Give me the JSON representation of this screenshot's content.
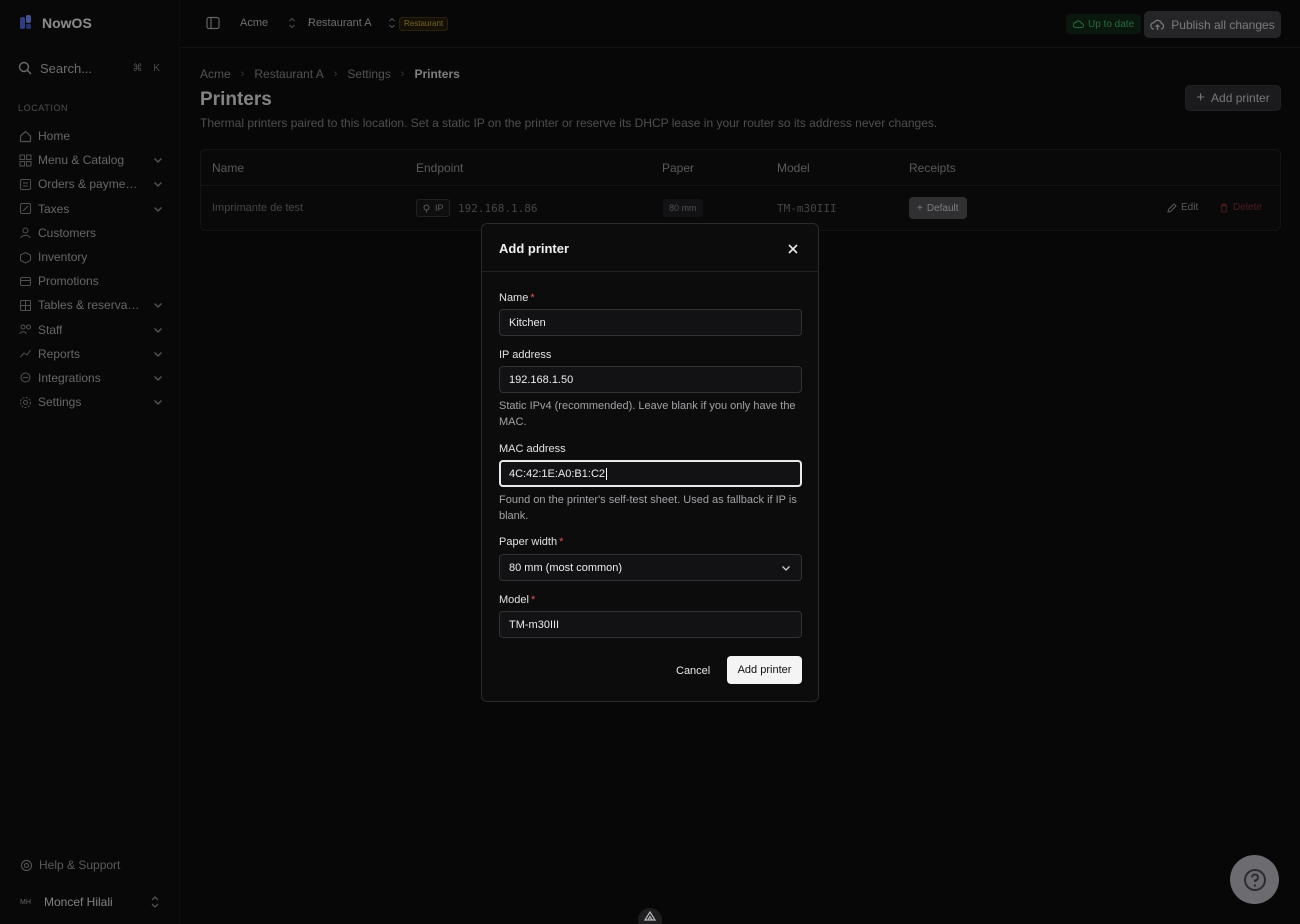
{
  "app": {
    "name": "NowOS"
  },
  "sidebar": {
    "search_placeholder": "Search...",
    "search_shortcut": "⌘ K",
    "section_label": "LOCATION",
    "items": [
      {
        "label": "Home",
        "icon": "home-icon",
        "expandable": false
      },
      {
        "label": "Menu & Catalog",
        "icon": "grid-icon",
        "expandable": true
      },
      {
        "label": "Orders & payments",
        "icon": "receipt-icon",
        "expandable": true
      },
      {
        "label": "Taxes",
        "icon": "percent-icon",
        "expandable": true
      },
      {
        "label": "Customers",
        "icon": "users-icon",
        "expandable": false
      },
      {
        "label": "Inventory",
        "icon": "box-icon",
        "expandable": false
      },
      {
        "label": "Promotions",
        "icon": "tag-icon",
        "expandable": false
      },
      {
        "label": "Tables & reservations",
        "icon": "table-icon",
        "expandable": true
      },
      {
        "label": "Staff",
        "icon": "staff-icon",
        "expandable": true
      },
      {
        "label": "Reports",
        "icon": "chart-icon",
        "expandable": true
      },
      {
        "label": "Integrations",
        "icon": "plug-icon",
        "expandable": true
      },
      {
        "label": "Settings",
        "icon": "gear-icon",
        "expandable": true
      }
    ],
    "help_label": "Help & Support",
    "user": {
      "initials": "MH",
      "name": "Moncef Hilali"
    }
  },
  "topbar": {
    "org": "Acme",
    "separator": "/",
    "location": "Restaurant A",
    "location_tag": "Restaurant",
    "status": "Up to date",
    "publish_label": "Publish all changes"
  },
  "page": {
    "breadcrumb": [
      "Acme",
      "Restaurant A",
      "Settings",
      "Printers"
    ],
    "title": "Printers",
    "description": "Thermal printers paired to this location. Set a static IP on the printer or reserve its DHCP lease in your router so its address never changes.",
    "add_button": "Add printer"
  },
  "table": {
    "columns": [
      "Name",
      "Endpoint",
      "Paper",
      "Model",
      "Receipts"
    ],
    "rows": [
      {
        "name": "Imprimante de test",
        "endpoint_type": "IP",
        "endpoint": "192.168.1.86",
        "paper": "80 mm",
        "model": "TM-m30III",
        "receipts": "Default",
        "edit": "Edit",
        "delete": "Delete"
      }
    ]
  },
  "modal": {
    "title": "Add printer",
    "name": {
      "label": "Name",
      "value": "Kitchen"
    },
    "ip": {
      "label": "IP address",
      "value": "192.168.1.50",
      "hint": "Static IPv4 (recommended). Leave blank if you only have the MAC."
    },
    "mac": {
      "label": "MAC address",
      "value": "4C:42:1E:A0:B1:C2",
      "hint": "Found on the printer's self-test sheet. Used as fallback if IP is blank."
    },
    "paper": {
      "label": "Paper width",
      "value": "80 mm (most common)"
    },
    "model": {
      "label": "Model",
      "value": "TM-m30III"
    },
    "required_mark": "*",
    "cancel_label": "Cancel",
    "submit_label": "Add printer"
  },
  "colors": {
    "accent": "#f4f4f5",
    "danger": "#e0524f",
    "success": "#3fa35f",
    "warning_tag": "#b69a2c"
  }
}
